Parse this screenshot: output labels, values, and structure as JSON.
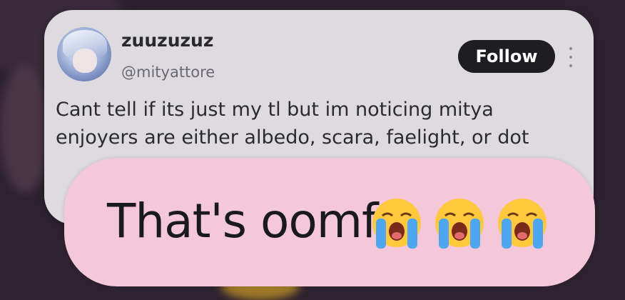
{
  "tweet": {
    "display_name": "zuuzuzuz",
    "handle": "@mityattore",
    "follow_label": "Follow",
    "text": "Cant tell if its just my tl but im noticing mitya enjoyers are either albedo, scara, faelight, or dot"
  },
  "caption": {
    "text": "That's oomf",
    "emojis": [
      "loudly-crying-face",
      "loudly-crying-face",
      "loudly-crying-face"
    ]
  },
  "colors": {
    "card_background": "#dedbe0",
    "caption_background": "#f4c7d9",
    "follow_button": "#1e1e22",
    "page_background": "#2e2230"
  }
}
